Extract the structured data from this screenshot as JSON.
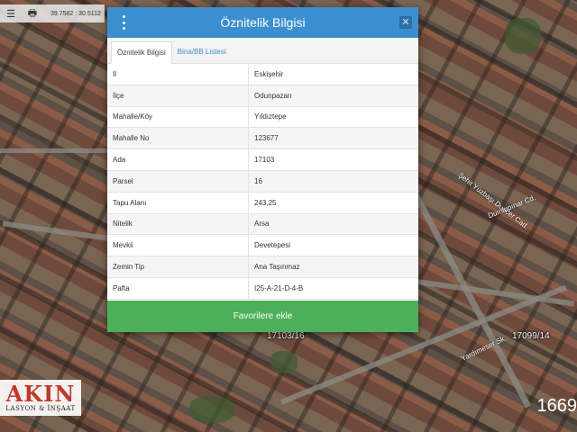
{
  "map": {
    "coordinates": "39.7582 : 30.5112",
    "parcel_labels": [
      "17103/16",
      "17099/14"
    ],
    "street_labels": [
      "Şehit Yüzbaşı Duncer Cad.",
      "Dumlupınar Cd.",
      "Yardımeser Sk."
    ],
    "logo": {
      "main": "AKIN",
      "sub": "LASYON & İNŞAAT"
    },
    "side_number": "1669"
  },
  "toolbar": {
    "icons": [
      "menu-icon",
      "print-icon"
    ]
  },
  "modal": {
    "title": "Öznitelik Bilgisi",
    "tabs": [
      "Öznitelik Bilgisi",
      "Bina/BB Listesi"
    ],
    "rows": [
      {
        "key": "İl",
        "value": "Eskişehir"
      },
      {
        "key": "İlçe",
        "value": "Odunpazarı"
      },
      {
        "key": "Mahalle/Köy",
        "value": "Yıldıztepe"
      },
      {
        "key": "Mahalle No",
        "value": "123677"
      },
      {
        "key": "Ada",
        "value": "17103"
      },
      {
        "key": "Parsel",
        "value": "16"
      },
      {
        "key": "Tapu Alanı",
        "value": "243,25"
      },
      {
        "key": "Nitelik",
        "value": "Arsa"
      },
      {
        "key": "Mevkii",
        "value": "Devetepesi"
      },
      {
        "key": "Zemin Tip",
        "value": "Ana Taşınmaz"
      },
      {
        "key": "Pafta",
        "value": "I25-A-21-D-4-B"
      }
    ],
    "footer_button": "Favorilere ekle",
    "colors": {
      "header": "#3b8fd0",
      "footer": "#4cb05a"
    }
  }
}
